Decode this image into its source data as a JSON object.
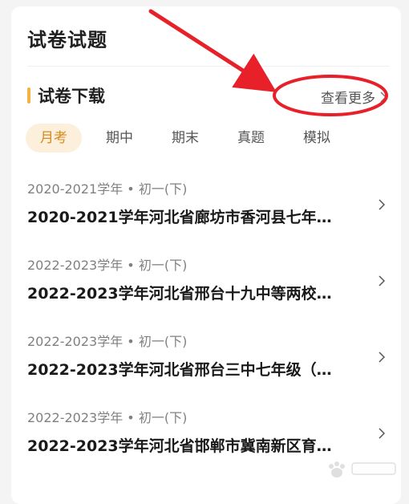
{
  "page": {
    "title": "试卷试题"
  },
  "section": {
    "title": "试卷下载",
    "more_label": "查看更多"
  },
  "tabs": [
    {
      "label": "月考",
      "active": true
    },
    {
      "label": "期中",
      "active": false
    },
    {
      "label": "期末",
      "active": false
    },
    {
      "label": "真题",
      "active": false
    },
    {
      "label": "模拟",
      "active": false
    }
  ],
  "items": [
    {
      "meta": "2020-2021学年 • 初一(下)",
      "title": "2020-2021学年河北省廊坊市香河县七年…"
    },
    {
      "meta": "2022-2023学年 • 初一(下)",
      "title": "2022-2023学年河北省邢台十九中等两校…"
    },
    {
      "meta": "2022-2023学年 • 初一(下)",
      "title": "2022-2023学年河北省邢台三中七年级（…"
    },
    {
      "meta": "2022-2023学年 • 初一(下)",
      "title": "2022-2023学年河北省邯郸市冀南新区育…"
    }
  ],
  "colors": {
    "accent": "#f6b23e",
    "tab_active_bg": "#fcf0dc",
    "tab_active_text": "#d68a1e",
    "annotation_red": "#e8202a"
  },
  "icons": {
    "more_chevron": "chevron-right-icon",
    "item_chevron": "chevron-right-icon"
  }
}
